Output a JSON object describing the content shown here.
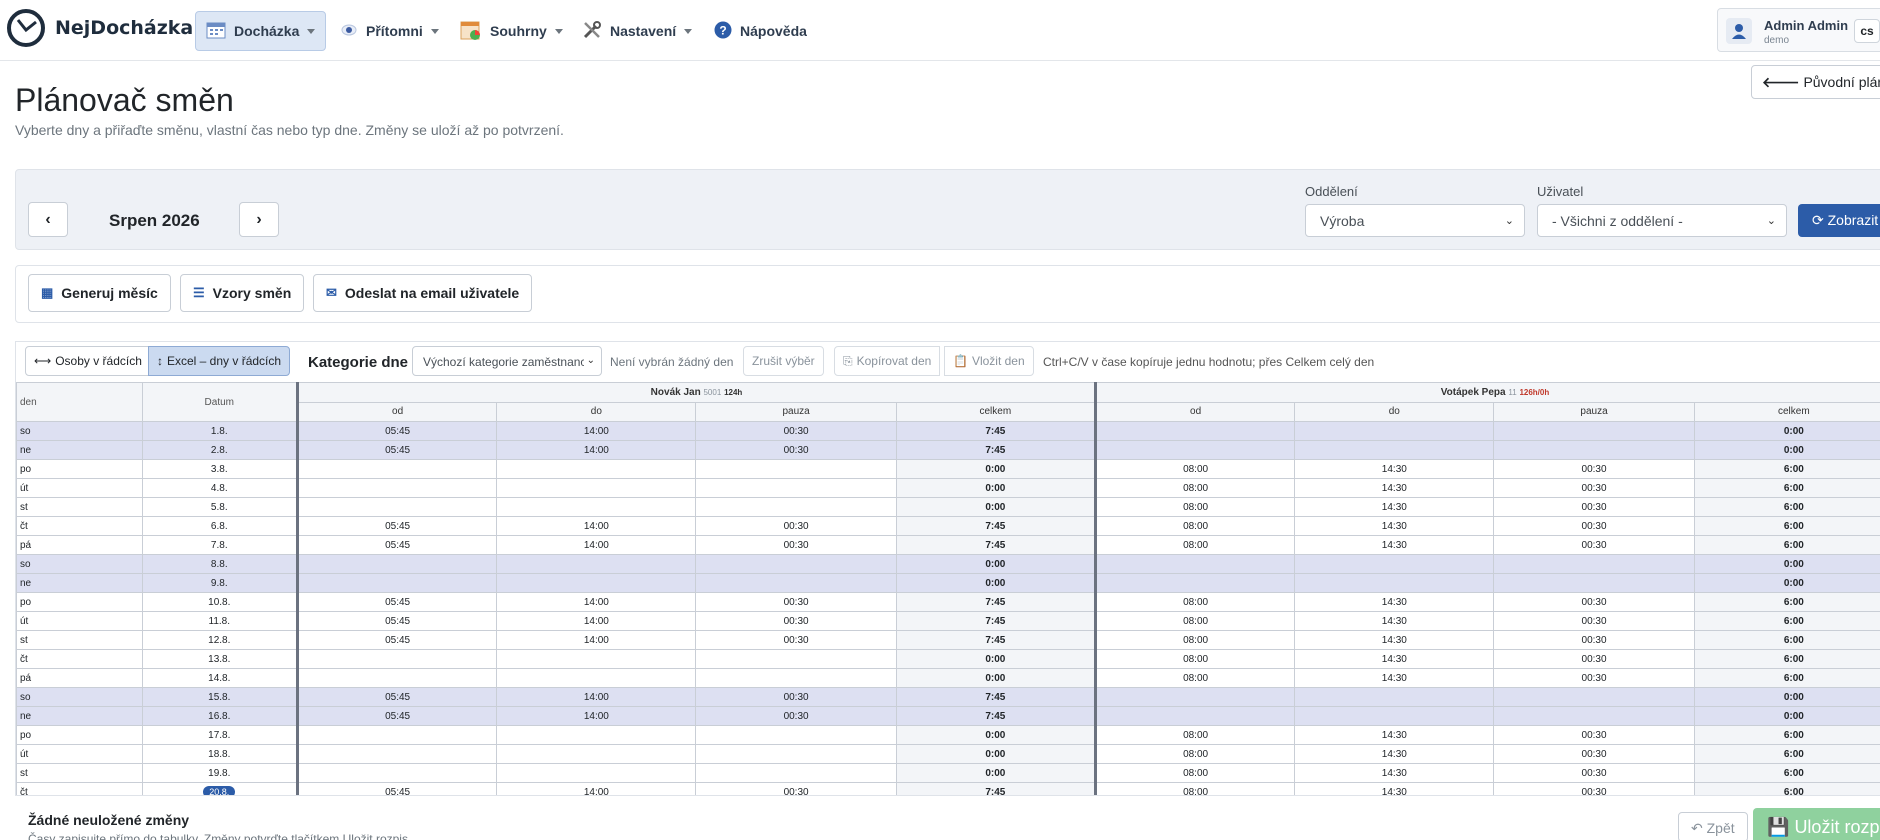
{
  "brand": {
    "name": "NejDocházka"
  },
  "nav": [
    {
      "label": "Docházka",
      "icon": "calendar-icon",
      "active": true,
      "dropdown": true
    },
    {
      "label": "Přítomni",
      "icon": "eye-icon",
      "dropdown": true
    },
    {
      "label": "Souhrny",
      "icon": "chart-icon",
      "dropdown": true
    },
    {
      "label": "Nastavení",
      "icon": "tools-icon",
      "dropdown": true
    },
    {
      "label": "Nápověda",
      "icon": "help-icon",
      "dropdown": false
    }
  ],
  "user": {
    "name": "Admin Admin",
    "role": "demo",
    "lang": "cs"
  },
  "page": {
    "title": "Plánovač směn",
    "subtitle": "Vyberte dny a přiřaďte směnu, vlastní čas nebo typ dne. Změny se uloží až po potvrzení.",
    "original_button": "Původní plánova"
  },
  "filter": {
    "month": "Srpen 2026",
    "department_label": "Oddělení",
    "department_value": "Výroba",
    "user_label": "Uživatel",
    "user_value": "- Všichni z oddělení -",
    "show_button": "Zobrazit"
  },
  "actions": {
    "generate": "Generuj měsíc",
    "templates": "Vzory směn",
    "email": "Odeslat na email uživatele"
  },
  "toolbar": {
    "persons_rows": "Osoby v řádcích",
    "excel_days": "Excel – dny v řádcích",
    "category_label": "Kategorie dne",
    "category_value": "Výchozí kategorie zaměstnance",
    "no_day": "Není vybrán žádný den",
    "cancel_selection": "Zrušit výběr",
    "copy_day": "Kopírovat den",
    "paste_day": "Vložit den",
    "hint": "Ctrl+C/V v čase kopíruje jednu hodnotu; přes Celkem celý den"
  },
  "table": {
    "col_day": "den",
    "col_date": "Datum",
    "employees": [
      {
        "name": "Novák Jan",
        "code": "5001",
        "hours": "124h",
        "hours_warn": false
      },
      {
        "name": "Votápek Pepa",
        "code": "11",
        "hours": "126h/0h",
        "hours_warn": true
      }
    ],
    "subcols": [
      "od",
      "do",
      "pauza",
      "celkem"
    ],
    "rows": [
      {
        "den": "so",
        "datum": "1.8.",
        "we": true,
        "a": [
          "05:45",
          "14:00",
          "00:30",
          "7:45"
        ],
        "b": [
          "",
          "",
          "",
          "0:00"
        ]
      },
      {
        "den": "ne",
        "datum": "2.8.",
        "we": true,
        "a": [
          "05:45",
          "14:00",
          "00:30",
          "7:45"
        ],
        "b": [
          "",
          "",
          "",
          "0:00"
        ]
      },
      {
        "den": "po",
        "datum": "3.8.",
        "we": false,
        "a": [
          "",
          "",
          "",
          "0:00"
        ],
        "b": [
          "08:00",
          "14:30",
          "00:30",
          "6:00"
        ]
      },
      {
        "den": "út",
        "datum": "4.8.",
        "we": false,
        "a": [
          "",
          "",
          "",
          "0:00"
        ],
        "b": [
          "08:00",
          "14:30",
          "00:30",
          "6:00"
        ]
      },
      {
        "den": "st",
        "datum": "5.8.",
        "we": false,
        "a": [
          "",
          "",
          "",
          "0:00"
        ],
        "b": [
          "08:00",
          "14:30",
          "00:30",
          "6:00"
        ]
      },
      {
        "den": "čt",
        "datum": "6.8.",
        "we": false,
        "a": [
          "05:45",
          "14:00",
          "00:30",
          "7:45"
        ],
        "b": [
          "08:00",
          "14:30",
          "00:30",
          "6:00"
        ]
      },
      {
        "den": "pá",
        "datum": "7.8.",
        "we": false,
        "a": [
          "05:45",
          "14:00",
          "00:30",
          "7:45"
        ],
        "b": [
          "08:00",
          "14:30",
          "00:30",
          "6:00"
        ]
      },
      {
        "den": "so",
        "datum": "8.8.",
        "we": true,
        "a": [
          "",
          "",
          "",
          "0:00"
        ],
        "b": [
          "",
          "",
          "",
          "0:00"
        ]
      },
      {
        "den": "ne",
        "datum": "9.8.",
        "we": true,
        "a": [
          "",
          "",
          "",
          "0:00"
        ],
        "b": [
          "",
          "",
          "",
          "0:00"
        ]
      },
      {
        "den": "po",
        "datum": "10.8.",
        "we": false,
        "a": [
          "05:45",
          "14:00",
          "00:30",
          "7:45"
        ],
        "b": [
          "08:00",
          "14:30",
          "00:30",
          "6:00"
        ]
      },
      {
        "den": "út",
        "datum": "11.8.",
        "we": false,
        "a": [
          "05:45",
          "14:00",
          "00:30",
          "7:45"
        ],
        "b": [
          "08:00",
          "14:30",
          "00:30",
          "6:00"
        ]
      },
      {
        "den": "st",
        "datum": "12.8.",
        "we": false,
        "a": [
          "05:45",
          "14:00",
          "00:30",
          "7:45"
        ],
        "b": [
          "08:00",
          "14:30",
          "00:30",
          "6:00"
        ]
      },
      {
        "den": "čt",
        "datum": "13.8.",
        "we": false,
        "a": [
          "",
          "",
          "",
          "0:00"
        ],
        "b": [
          "08:00",
          "14:30",
          "00:30",
          "6:00"
        ]
      },
      {
        "den": "pá",
        "datum": "14.8.",
        "we": false,
        "a": [
          "",
          "",
          "",
          "0:00"
        ],
        "b": [
          "08:00",
          "14:30",
          "00:30",
          "6:00"
        ]
      },
      {
        "den": "so",
        "datum": "15.8.",
        "we": true,
        "a": [
          "05:45",
          "14:00",
          "00:30",
          "7:45"
        ],
        "b": [
          "",
          "",
          "",
          "0:00"
        ]
      },
      {
        "den": "ne",
        "datum": "16.8.",
        "we": true,
        "a": [
          "05:45",
          "14:00",
          "00:30",
          "7:45"
        ],
        "b": [
          "",
          "",
          "",
          "0:00"
        ]
      },
      {
        "den": "po",
        "datum": "17.8.",
        "we": false,
        "a": [
          "",
          "",
          "",
          "0:00"
        ],
        "b": [
          "08:00",
          "14:30",
          "00:30",
          "6:00"
        ]
      },
      {
        "den": "út",
        "datum": "18.8.",
        "we": false,
        "a": [
          "",
          "",
          "",
          "0:00"
        ],
        "b": [
          "08:00",
          "14:30",
          "00:30",
          "6:00"
        ]
      },
      {
        "den": "st",
        "datum": "19.8.",
        "we": false,
        "a": [
          "",
          "",
          "",
          "0:00"
        ],
        "b": [
          "08:00",
          "14:30",
          "00:30",
          "6:00"
        ]
      },
      {
        "den": "čt",
        "datum": "20.8.",
        "we": false,
        "today": true,
        "a": [
          "05:45",
          "14:00",
          "00:30",
          "7:45"
        ],
        "b": [
          "08:00",
          "14:30",
          "00:30",
          "6:00"
        ]
      }
    ]
  },
  "footer": {
    "status": "Žádné neuložené změny",
    "hint": "Časy zapisujte přímo do tabulky. Změny potvrďte tlačítkem Uložit rozpis.",
    "back": "Zpět",
    "save": "Uložit rozpis"
  },
  "colors": {
    "accent": "#2c5ca8",
    "weekend_row": "#dde0f2",
    "save_disabled": "#8fd19e"
  }
}
